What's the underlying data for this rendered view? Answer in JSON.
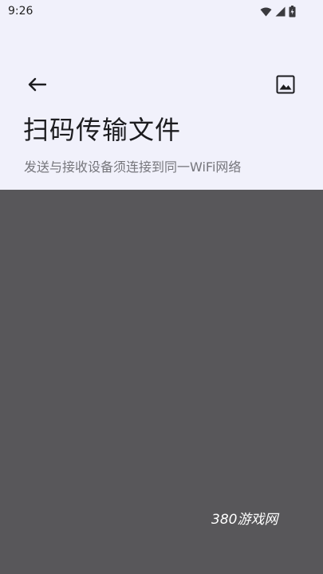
{
  "status_bar": {
    "time": "9:26",
    "icons": [
      "wifi-icon",
      "signal-icon",
      "battery-icon"
    ]
  },
  "header": {
    "back_icon": "arrow-left-icon",
    "image_icon": "image-icon",
    "title": "扫码传输文件",
    "subtitle": "发送与接收设备须连接到同一WiFi网络"
  },
  "watermark": {
    "text": "380游戏网"
  },
  "colors": {
    "header_bg": "#f1f1fb",
    "camera_bg": "#58575a",
    "title_text": "#1c1c1f",
    "subtitle_text": "#76767c"
  }
}
